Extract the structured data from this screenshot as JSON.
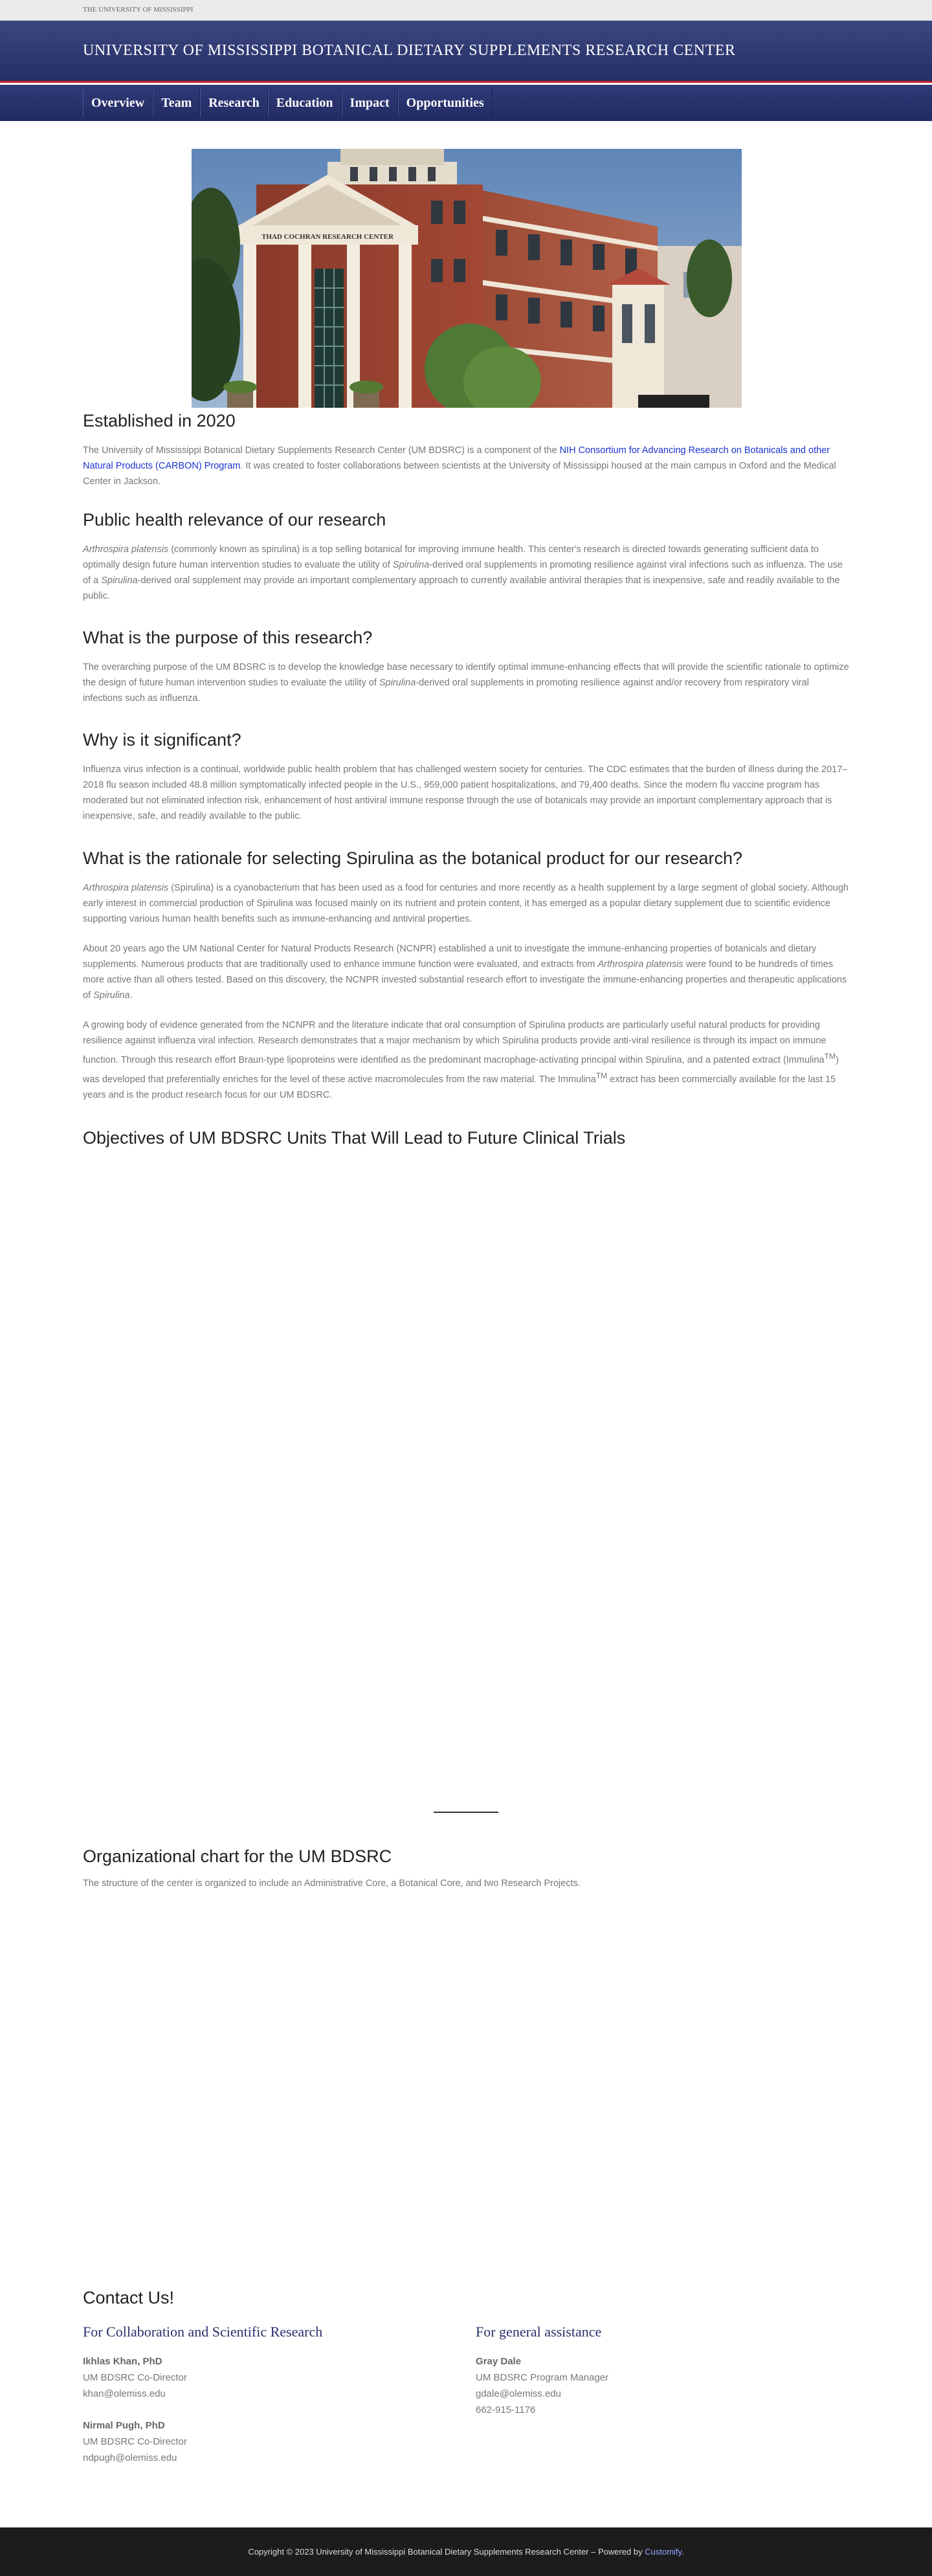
{
  "topbar": {
    "text": "THE UNIVERSITY OF MISSISSIPPI"
  },
  "masthead": {
    "title": "UNIVERSITY OF MISSISSIPPI BOTANICAL DIETARY SUPPLEMENTS RESEARCH CENTER"
  },
  "nav": {
    "items": [
      "Overview",
      "Team",
      "Research",
      "Education",
      "Impact",
      "Opportunities"
    ]
  },
  "hero": {
    "building_sign": "THAD COCHRAN RESEARCH CENTER"
  },
  "sections": {
    "established": {
      "heading": "Established in 2020",
      "p1_before": "The University of Mississippi Botanical Dietary Supplements Research Center (UM BDSRC) is a component of the ",
      "p1_link": "NIH Consortium for Advancing Research on Botanicals and other Natural Products (CARBON) Program",
      "p1_after": ". It was created to foster collaborations between scientists at the University of Mississippi housed at the main campus in Oxford and the Medical Center in Jackson."
    },
    "public_health": {
      "heading": "Public health relevance of our research",
      "p1_em1": "Arthrospira platensis",
      "p1_a": " (commonly known as spirulina) is a top selling botanical for improving immune health. This center's research is directed towards generating sufficient data to optimally design future human intervention studies to evaluate the utility of ",
      "p1_em2": "Spirulina",
      "p1_b": "-derived oral supplements in promoting resilience against viral infections such as influenza. The use of a ",
      "p1_em3": "Spirulina",
      "p1_c": "-derived oral supplement may provide an important complementary approach to currently available antiviral therapies that is inexpensive, safe and readily available to the public."
    },
    "purpose": {
      "heading": "What is the purpose of this research?",
      "p1_a": "The overarching purpose of the UM BDSRC is to develop the knowledge base necessary to identify optimal immune-enhancing effects that will provide the scientific rationale to optimize the design of future human intervention studies to evaluate the utility of ",
      "p1_em": "Spirulina",
      "p1_b": "-derived oral supplements in promoting resilience against and/or recovery from respiratory viral infections such as influenza."
    },
    "significant": {
      "heading": "Why is it significant?",
      "p1": "Influenza virus infection is a continual, worldwide public health problem that has challenged western society for centuries. The CDC estimates that the burden of illness during the 2017–2018 flu season included 48.8 million symptomatically infected people in the U.S., 959,000 patient hospitalizations, and 79,400 deaths. Since the modern flu vaccine program has moderated but not eliminated infection risk, enhancement of host antiviral immune response through the use of botanicals may provide an important complementary approach that is inexpensive, safe, and readily available to the public."
    },
    "rationale": {
      "heading": "What is the rationale for selecting Spirulina as the botanical product for our research?",
      "p1_em": "Arthrospira platensis",
      "p1_a": " (Spirulina) is a cyanobacterium that has been used as a food for centuries and more recently as a health supplement by a large segment of global society. Although early interest in commercial production of Spirulina was focused mainly on its nutrient and protein content, it has emerged as a popular dietary supplement due to scientific evidence supporting various human health benefits such as immune-enhancing and antiviral properties.",
      "p2_a": "About 20 years ago the UM National Center for Natural Products Research (NCNPR) established a unit to investigate the immune-enhancing properties of botanicals and dietary supplements. Numerous products that are traditionally used to enhance immune function were evaluated, and extracts from ",
      "p2_em": "Arthrospira platensis",
      "p2_b": " were found to be hundreds of times more active than all others tested. Based on this discovery, the NCNPR invested substantial research effort to investigate the immune-enhancing properties and therapeutic applications of ",
      "p2_em2": "Spirulina",
      "p2_c": ".",
      "p3_a": "A growing body of evidence generated from the NCNPR and the literature indicate that oral consumption of Spirulina products are particularly useful natural products for providing resilience against influenza viral infection. Research demonstrates that a major mechanism by which Spirulina products provide anti-viral resilience is through its impact on immune function. Through this research effort Braun-type lipoproteins were identified as the predominant macrophage-activating principal within Spirulina, and a patented extract (Immulina",
      "p3_tm1": "TM",
      "p3_b": ") was developed that preferentially enriches for the level of these active macromolecules from the raw material. The Immulina",
      "p3_tm2": "TM",
      "p3_c": " extract has been commercially available for the last 15 years and is the product research focus for our UM BDSRC."
    },
    "objectives": {
      "heading": "Objectives of UM BDSRC Units That Will Lead to Future Clinical Trials"
    },
    "org_chart": {
      "heading": "Organizational chart for the UM BDSRC",
      "p1": "The structure of the center is organized to include an Administrative Core, a Botanical Core, and two Research Projects."
    }
  },
  "contact": {
    "heading": "Contact Us!",
    "left_heading": "For Collaboration and Scientific Research",
    "right_heading": "For general assistance",
    "people_left": [
      {
        "name": "Ikhlas Khan, PhD",
        "role": "UM BDSRC Co-Director",
        "email": "khan@olemiss.edu"
      },
      {
        "name": "Nirmal Pugh, PhD",
        "role": "UM BDSRC Co-Director",
        "email": "ndpugh@olemiss.edu"
      }
    ],
    "people_right": [
      {
        "name": "Gray Dale",
        "role": "UM BDSRC Program Manager",
        "email": "gdale@olemiss.edu",
        "phone": "662-915-1176"
      }
    ]
  },
  "footer": {
    "text": "Copyright © 2023 University of Mississippi Botanical Dietary Supplements Research Center – Powered by ",
    "link": "Customify",
    "end": "."
  },
  "colors": {
    "nav_bg": "#262f66",
    "accent_red": "#c0222c",
    "link": "#1a33d0",
    "footer_bg": "#1c1c1c"
  }
}
